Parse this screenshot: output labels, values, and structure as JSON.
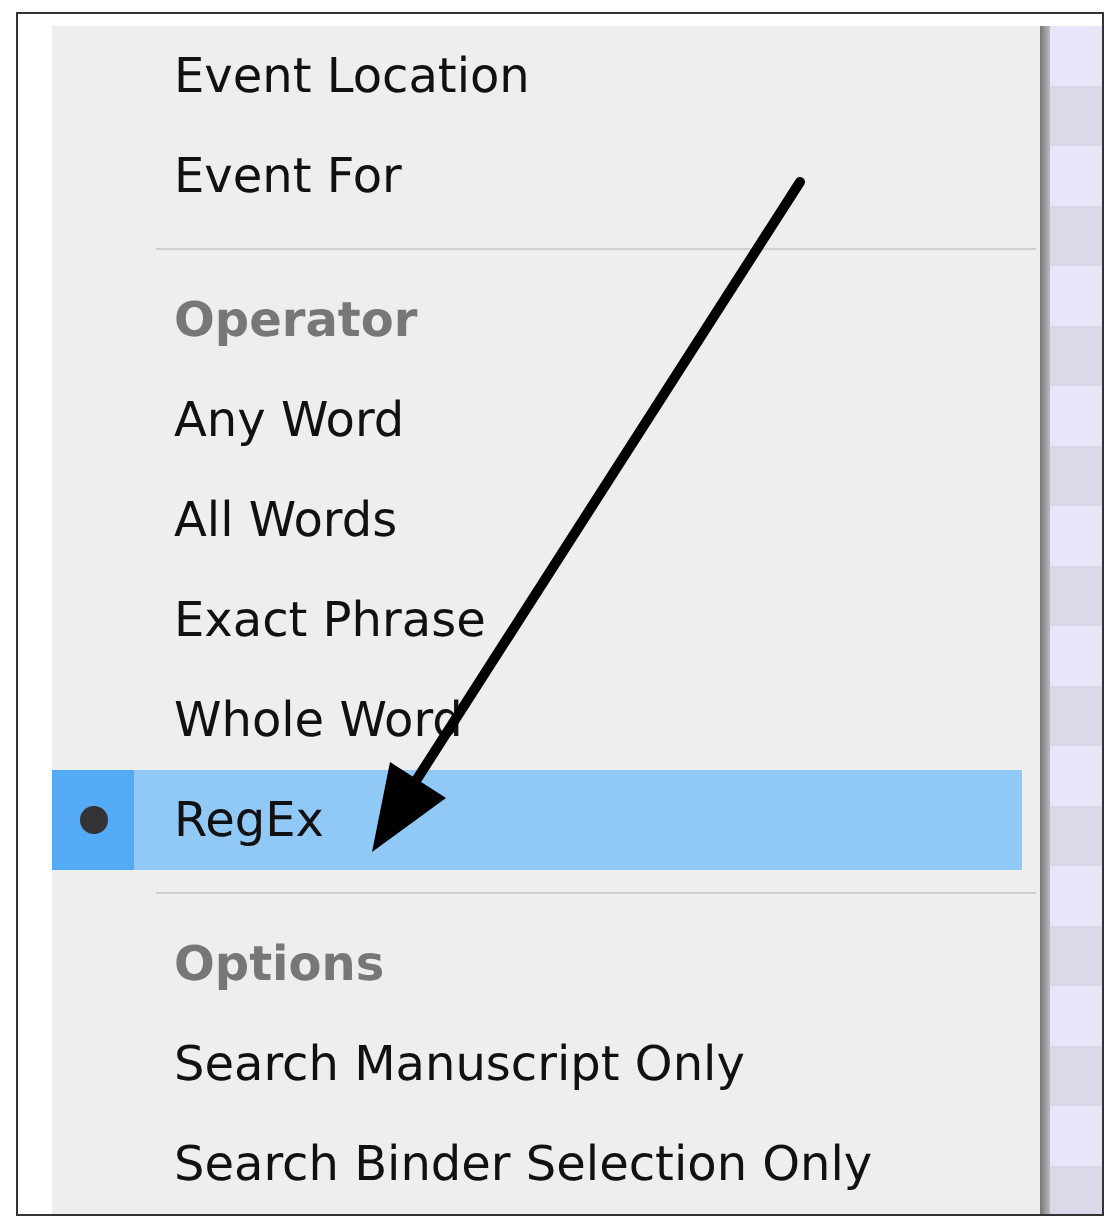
{
  "menu": {
    "items": [
      {
        "kind": "item",
        "label": "Event Location"
      },
      {
        "kind": "item",
        "label": "Event For"
      },
      {
        "kind": "separator"
      },
      {
        "kind": "header",
        "label": "Operator"
      },
      {
        "kind": "radio",
        "label": "Any Word",
        "selected": false
      },
      {
        "kind": "radio",
        "label": "All Words",
        "selected": false
      },
      {
        "kind": "radio",
        "label": "Exact Phrase",
        "selected": false
      },
      {
        "kind": "radio",
        "label": "Whole Word",
        "selected": false
      },
      {
        "kind": "radio",
        "label": "RegEx",
        "selected": true
      },
      {
        "kind": "separator"
      },
      {
        "kind": "header",
        "label": "Options"
      },
      {
        "kind": "item",
        "label": "Search Manuscript Only"
      },
      {
        "kind": "item",
        "label": "Search Binder Selection Only"
      }
    ]
  }
}
